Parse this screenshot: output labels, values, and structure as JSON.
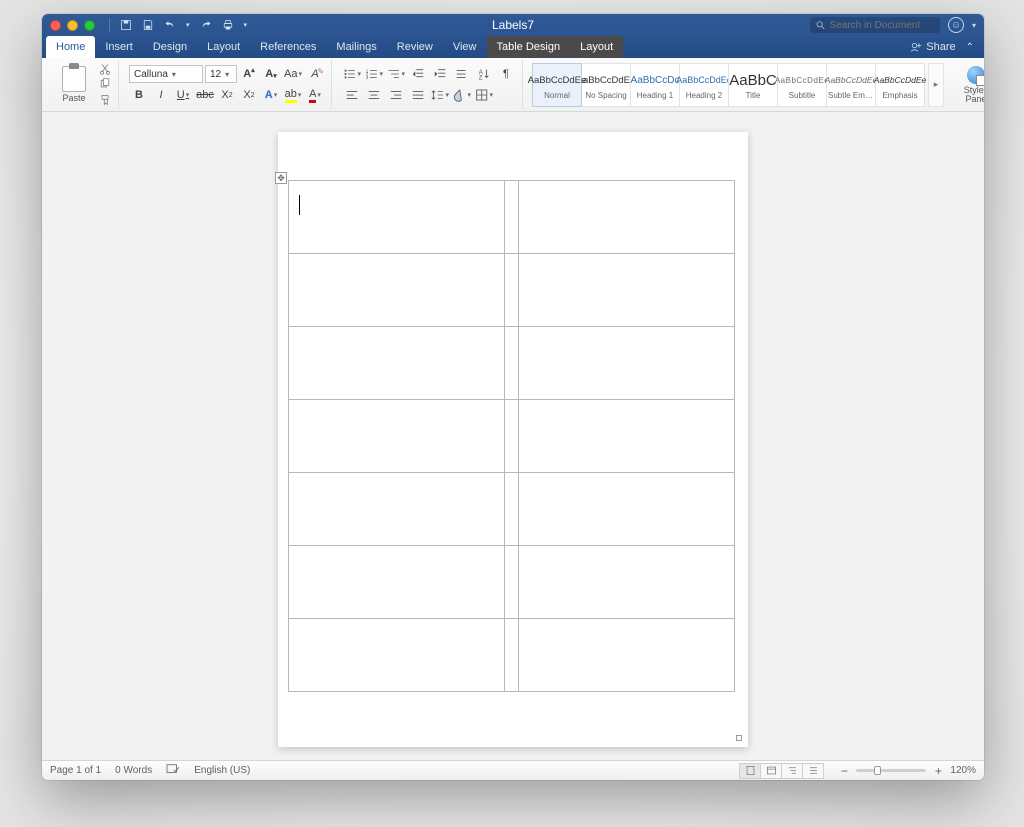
{
  "window": {
    "title": "Labels7",
    "search_placeholder": "Search in Document",
    "share_label": "Share"
  },
  "tabs": {
    "items": [
      "Home",
      "Insert",
      "Design",
      "Layout",
      "References",
      "Mailings",
      "Review",
      "View",
      "Table Design",
      "Layout"
    ],
    "active_index": 0,
    "context_indices": [
      8,
      9
    ]
  },
  "ribbon": {
    "paste_label": "Paste",
    "font_name": "Calluna",
    "font_size": "12",
    "styles": [
      {
        "preview": "AaBbCcDdEe",
        "name": "Normal",
        "cls": "sel"
      },
      {
        "preview": "AaBbCcDdEe",
        "name": "No Spacing",
        "cls": ""
      },
      {
        "preview": "AaBbCcDc",
        "name": "Heading 1",
        "cls": "style-h1"
      },
      {
        "preview": "AaBbCcDdEe",
        "name": "Heading 2",
        "cls": "style-h2"
      },
      {
        "preview": "AaBbC",
        "name": "Title",
        "cls": "style-title"
      },
      {
        "preview": "AaBbCcDdEe",
        "name": "Subtitle",
        "cls": "style-subtitle"
      },
      {
        "preview": "AaBbCcDdEe",
        "name": "Subtle Emph...",
        "cls": "style-se"
      },
      {
        "preview": "AaBbCcDdEe",
        "name": "Emphasis",
        "cls": "style-emph"
      }
    ],
    "styles_pane_label": "Styles\nPane"
  },
  "status": {
    "page": "Page 1 of 1",
    "words": "0 Words",
    "language": "English (US)",
    "zoom": "120%"
  }
}
